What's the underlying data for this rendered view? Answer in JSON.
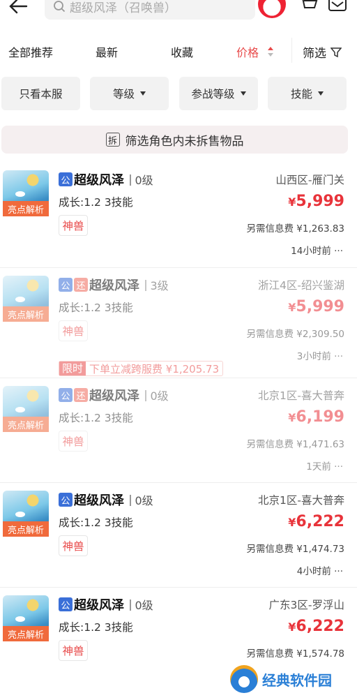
{
  "header": {
    "search_placeholder": "超级风泽（召唤兽）"
  },
  "sort_tabs": [
    {
      "label": "全部推荐"
    },
    {
      "label": "最新"
    },
    {
      "label": "收藏"
    },
    {
      "label": "价格"
    }
  ],
  "filter_label": "筛选",
  "chips": [
    {
      "label": "只看本服"
    },
    {
      "label": "等级"
    },
    {
      "label": "参战等级"
    },
    {
      "label": "技能"
    }
  ],
  "banner": {
    "icon_text": "拆",
    "text": "筛选角色内未拆售物品"
  },
  "highlight_label": "亮点解析",
  "beast_label": "神兽",
  "tag_gong": "公",
  "tag_huan": "还",
  "items": [
    {
      "name": "超级风泽",
      "level": "0级",
      "growth": "成长:1.2 3技能",
      "region": "山西区-雁门关",
      "price": "5,999",
      "fee": "另需信息费 ¥1,263.83",
      "time": "14小时前 ···",
      "faded": false
    },
    {
      "name": "超级风泽",
      "level": "3级",
      "growth": "成长:1.2 3技能",
      "region": "浙江4区-绍兴鉴湖",
      "price": "5,999",
      "fee": "另需信息费 ¥2,309.50",
      "time": "3小时前 ···",
      "faded": true,
      "promo_tag": "限时",
      "promo_text": "下单立减跨服费 ¥1,205.73"
    },
    {
      "name": "超级风泽",
      "level": "0级",
      "growth": "成长:1.2 3技能",
      "region": "北京1区-喜大普奔",
      "price": "6,199",
      "fee": "另需信息费 ¥1,471.63",
      "time": "1天前 ···",
      "faded": true
    },
    {
      "name": "超级风泽",
      "level": "0级",
      "growth": "成长:1.2 3技能",
      "region": "北京1区-喜大普奔",
      "price": "6,222",
      "fee": "另需信息费 ¥1,474.73",
      "time": "4小时前 ···",
      "faded": false
    },
    {
      "name": "超级风泽",
      "level": "0级",
      "growth": "成长:1.2 3技能",
      "region": "广东3区-罗浮山",
      "price": "6,222",
      "fee": "另需信息费 ¥1,574.78",
      "time": "",
      "faded": false
    }
  ],
  "watermark": "经典软件园",
  "colors": {
    "accent": "#e8333a",
    "badge_blue": "#3a6fd8",
    "highlight": "#f06a3c"
  }
}
